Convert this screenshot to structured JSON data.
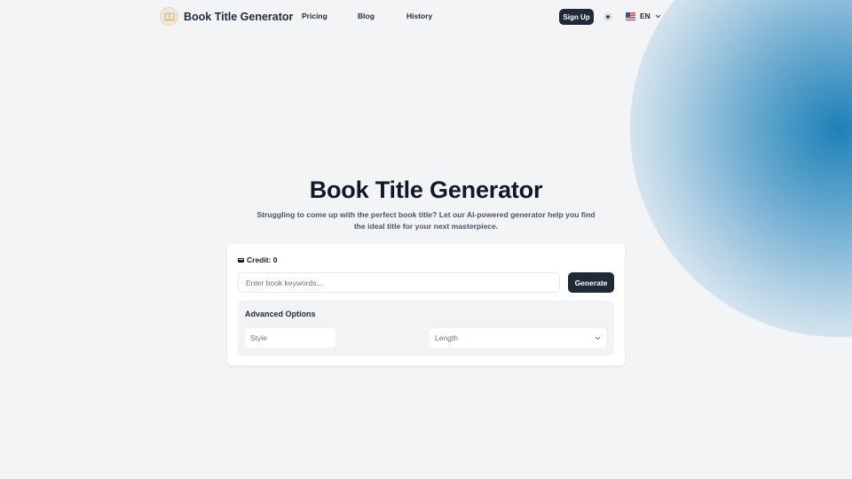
{
  "header": {
    "logo_text": "Book Title Generator",
    "logo_icon": "open-book-icon",
    "nav": [
      {
        "label": "Pricing"
      },
      {
        "label": "Blog"
      },
      {
        "label": "History"
      }
    ],
    "signup_label": "Sign Up",
    "theme_icon": "sun-icon",
    "language": {
      "code": "EN",
      "flag": "us-flag-icon"
    }
  },
  "hero": {
    "title": "Book Title Generator",
    "subtitle": "Struggling to come up with the perfect book title? Let our AI-powered generator help you find the ideal title for your next masterpiece."
  },
  "form": {
    "credit_label": "Credit: 0",
    "credit_icon": "credit-card-icon",
    "keywords_placeholder": "Enter book keywords...",
    "keywords_value": "",
    "generate_label": "Generate",
    "advanced": {
      "title": "Advanced Options",
      "style_placeholder": "Style",
      "length_selected": "Length"
    }
  },
  "colors": {
    "background": "#f3f4f6",
    "primary_button": "#1f2937",
    "accent_blob": "#1f80b8"
  }
}
